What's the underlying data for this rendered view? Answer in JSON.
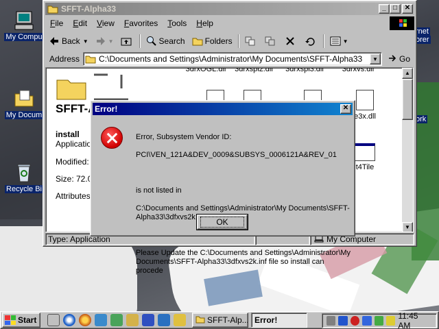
{
  "desktop": {
    "icons": [
      {
        "label": "My Compu"
      },
      {
        "label": "My Docum"
      },
      {
        "label": "Recycle Bi"
      }
    ],
    "right_icons": [
      {
        "label": "rnet"
      },
      {
        "label": "orer"
      },
      {
        "label": "ork"
      }
    ]
  },
  "explorer": {
    "title": "SFFT-Alpha33",
    "menu": [
      "File",
      "Edit",
      "View",
      "Favorites",
      "Tools",
      "Help"
    ],
    "toolbar": {
      "back": "Back",
      "search": "Search",
      "folders": "Folders"
    },
    "address": {
      "label": "Address",
      "value": "C:\\Documents and Settings\\Administrator\\My Documents\\SFFT-Alpha33",
      "go": "Go"
    },
    "webview": {
      "folder_name": "SFFT-A",
      "selected_name": "install",
      "selected_type": "Application",
      "modified": "Modified: 9",
      "size": "Size: 72.0",
      "attributes": "Attributes:"
    },
    "files": [
      {
        "name": "3drxOGL.dll"
      },
      {
        "name": "3drxspl2.dll"
      },
      {
        "name": "3drxspl3.dll"
      },
      {
        "name": "3drxvs.dll"
      },
      {
        "name": "e3x.dll"
      },
      {
        "name": "t4Tile"
      }
    ],
    "status": {
      "type": "Type: Application",
      "computer": "My Computer"
    }
  },
  "dialog": {
    "title": "Error!",
    "message_line1": "Error, Subsystem Vendor ID:",
    "message_line2": "PCI\\VEN_121A&DEV_0009&SUBSYS_0006121A&REV_01",
    "message_line3": "is not listed in",
    "message_line4": "C:\\Documents and Settings\\Administrator\\My Documents\\SFFT-Alpha33\\3dfxvs2k.inf",
    "message_line5": "Please Update the C:\\Documents and Settings\\Administrator\\My Documents\\SFFT-Alpha33\\3dfxvs2k.inf file so install can procede",
    "ok": "OK"
  },
  "taskbar": {
    "start": "Start",
    "tasks": [
      {
        "label": "SFFT-Alp..."
      },
      {
        "label": "Error!"
      }
    ],
    "clock": "11:45 AM"
  }
}
